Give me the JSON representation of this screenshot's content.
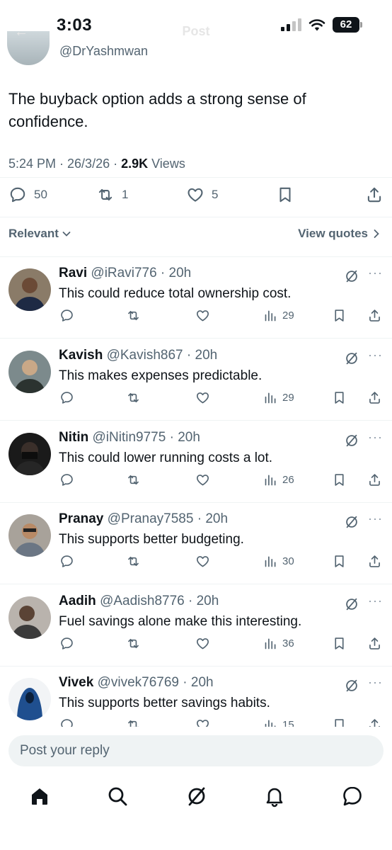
{
  "status_bar": {
    "time": "3:03",
    "battery": "62"
  },
  "header": {
    "title": "Post"
  },
  "post": {
    "author_handle": "@DrYashmwan",
    "text": "The buyback option adds a strong sense of confidence.",
    "timestamp": "5:24 PM · 26/3/26 · ",
    "views_count": "2.9K",
    "views_label": " Views",
    "replies": "50",
    "reposts": "1",
    "likes": "5"
  },
  "sort": {
    "label": "Relevant",
    "view_quotes": "View quotes"
  },
  "replies": [
    {
      "name": "Ravi",
      "handle": "@iRavi776",
      "time": "20h",
      "text": "This could reduce total ownership cost.",
      "views": "29"
    },
    {
      "name": "Kavish",
      "handle": "@Kavish867",
      "time": "20h",
      "text": "This makes expenses predictable.",
      "views": "29"
    },
    {
      "name": "Nitin",
      "handle": "@iNitin9775",
      "time": "20h",
      "text": "This could lower running costs a lot.",
      "views": "26"
    },
    {
      "name": "Pranay",
      "handle": "@Pranay7585",
      "time": "20h",
      "text": "This supports better budgeting.",
      "views": "30"
    },
    {
      "name": "Aadih",
      "handle": "@Aadish8776",
      "time": "20h",
      "text": "Fuel savings alone make this interesting.",
      "views": "36"
    },
    {
      "name": "Vivek",
      "handle": "@vivek76769",
      "time": "20h",
      "text": "This supports better savings habits.",
      "views": "15"
    }
  ],
  "reply_box": {
    "placeholder": "Post your reply"
  },
  "nav": [
    "home-icon",
    "search-icon",
    "grok-icon",
    "notifications-icon",
    "messages-icon"
  ],
  "colors": {
    "text": "#0f1419",
    "secondary": "#536471",
    "divider": "#eff3f4"
  }
}
